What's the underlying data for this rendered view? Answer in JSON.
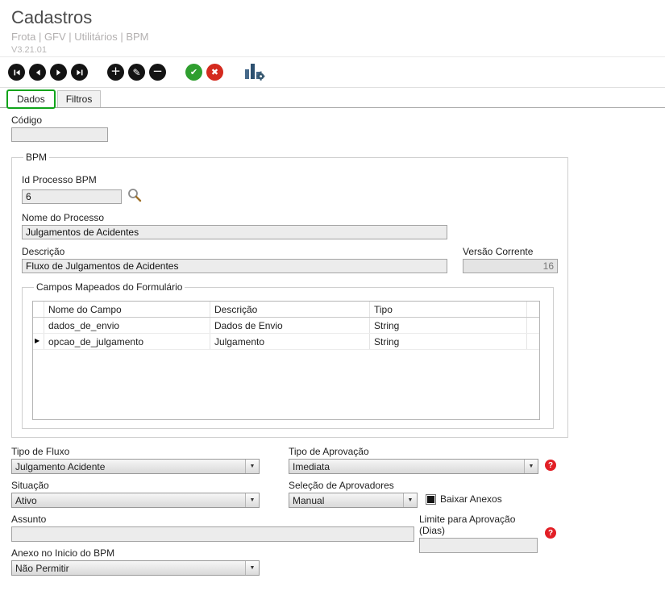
{
  "header": {
    "title": "Cadastros",
    "breadcrumb": "Frota | GFV | Utilitários | BPM",
    "version": "V3.21.01"
  },
  "icons": {
    "plus": "+",
    "minus": "−",
    "edit": "✎",
    "confirm": "✔",
    "cancel": "✖",
    "help": "?",
    "dropdown": "▼",
    "row_selector": "▶"
  },
  "tabs": {
    "dados": "Dados",
    "filtros": "Filtros"
  },
  "form": {
    "codigo": {
      "label": "Código",
      "value": ""
    },
    "bpm": {
      "title": "BPM",
      "id_processo": {
        "label": "Id Processo BPM",
        "value": "6"
      },
      "nome_processo": {
        "label": "Nome do Processo",
        "value": "Julgamentos de Acidentes"
      },
      "descricao": {
        "label": "Descrição",
        "value": "Fluxo de Julgamentos de Acidentes"
      },
      "versao_corrente": {
        "label": "Versão Corrente",
        "value": "16"
      },
      "campos": {
        "title": "Campos Mapeados do Formulário",
        "columns": [
          "Nome do Campo",
          "Descrição",
          "Tipo"
        ],
        "rows": [
          {
            "nome": "dados_de_envio",
            "descricao": "Dados de Envio",
            "tipo": "String"
          },
          {
            "nome": "opcao_de_julgamento",
            "descricao": "Julgamento",
            "tipo": "String"
          }
        ]
      }
    },
    "tipo_fluxo": {
      "label": "Tipo de Fluxo",
      "value": "Julgamento Acidente"
    },
    "tipo_aprovacao": {
      "label": "Tipo de Aprovação",
      "value": "Imediata"
    },
    "situacao": {
      "label": "Situação",
      "value": "Ativo"
    },
    "selecao_aprovadores": {
      "label": "Seleção de Aprovadores",
      "value": "Manual"
    },
    "baixar_anexos": {
      "label": "Baixar Anexos",
      "checked": true
    },
    "assunto": {
      "label": "Assunto",
      "value": ""
    },
    "limite_aprovacao": {
      "label": "Limite para Aprovação (Dias)",
      "value": ""
    },
    "anexo_inicio": {
      "label": "Anexo no Inicio do BPM",
      "value": "Não Permitir"
    }
  }
}
